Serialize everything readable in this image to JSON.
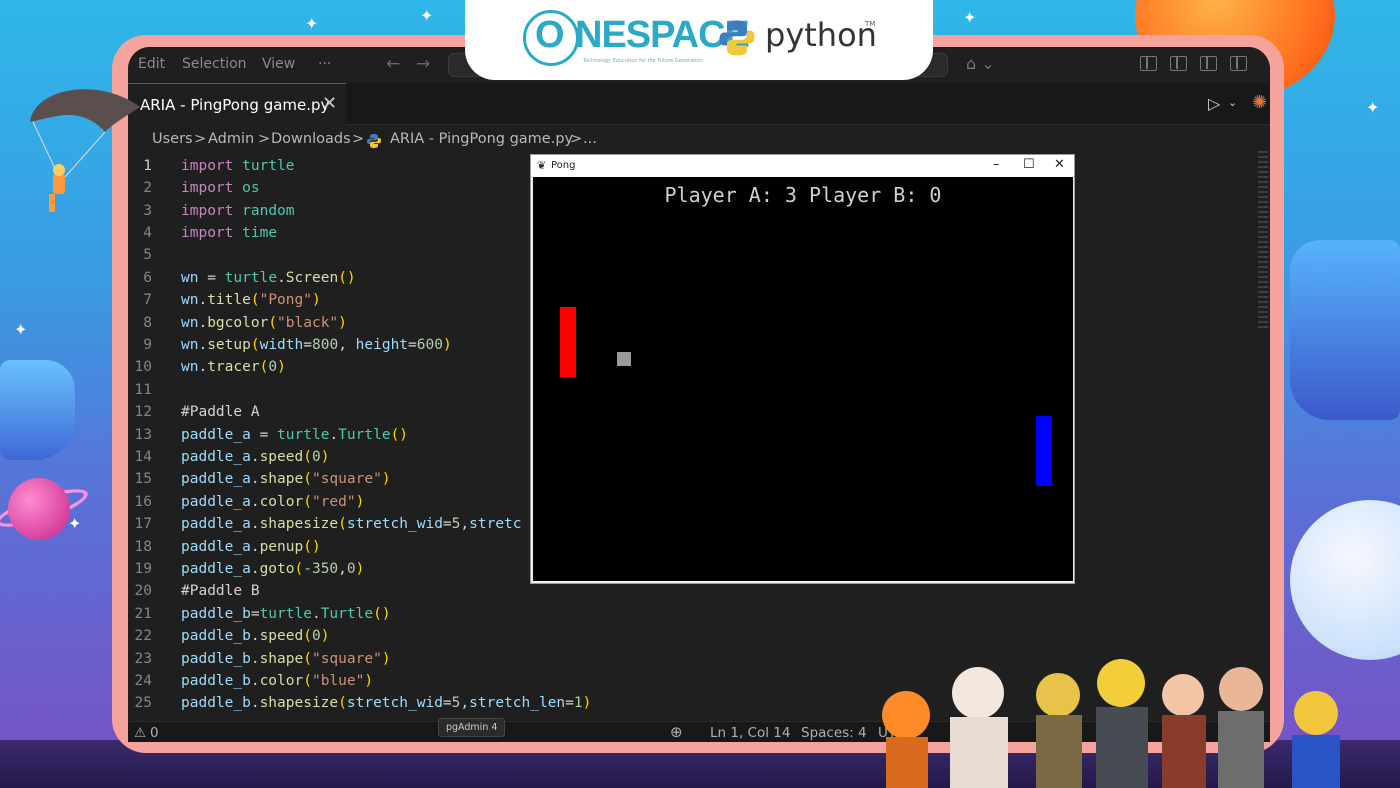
{
  "editor": {
    "menu": [
      "Edit",
      "Selection",
      "View",
      "···"
    ],
    "tab": {
      "label": "ARIA - PingPong game.py"
    },
    "breadcrumb": [
      "Users",
      "Admin",
      "Downloads",
      "ARIA - PingPong game.py",
      "..."
    ],
    "code_lines": [
      {
        "n": "1"
      },
      {
        "n": "2"
      },
      {
        "n": "3"
      },
      {
        "n": "4"
      },
      {
        "n": "5"
      },
      {
        "n": "6"
      },
      {
        "n": "7"
      },
      {
        "n": "8"
      },
      {
        "n": "9"
      },
      {
        "n": "10"
      },
      {
        "n": "11"
      },
      {
        "n": "12"
      },
      {
        "n": "13"
      },
      {
        "n": "14"
      },
      {
        "n": "15"
      },
      {
        "n": "16"
      },
      {
        "n": "17"
      },
      {
        "n": "18"
      },
      {
        "n": "19"
      },
      {
        "n": "20"
      },
      {
        "n": "21"
      },
      {
        "n": "22"
      },
      {
        "n": "23"
      },
      {
        "n": "24"
      },
      {
        "n": "25"
      }
    ],
    "code": {
      "l1": [
        "import",
        "turtle"
      ],
      "l2": [
        "import",
        "os"
      ],
      "l3": [
        "import",
        "random"
      ],
      "l4": [
        "import",
        "time"
      ],
      "l6": [
        "wn",
        " = ",
        "turtle",
        ".",
        "Screen",
        "()"
      ],
      "l7": [
        "wn",
        ".",
        "title",
        "(",
        "\"Pong\"",
        ")"
      ],
      "l8": [
        "wn",
        ".",
        "bgcolor",
        "(",
        "\"black\"",
        ")"
      ],
      "l9": [
        "wn",
        ".",
        "setup",
        "(",
        "width",
        "=",
        "800",
        ", ",
        "height",
        "=",
        "600",
        ")"
      ],
      "l10": [
        "wn",
        ".",
        "tracer",
        "(",
        "0",
        ")"
      ],
      "l12": "#Paddle A",
      "l13": [
        "paddle_a",
        " = ",
        "turtle",
        ".",
        "Turtle",
        "()"
      ],
      "l14": [
        "paddle_a",
        ".",
        "speed",
        "(",
        "0",
        ")"
      ],
      "l15": [
        "paddle_a",
        ".",
        "shape",
        "(",
        "\"square\"",
        ")"
      ],
      "l16": [
        "paddle_a",
        ".",
        "color",
        "(",
        "\"red\"",
        ")"
      ],
      "l17": [
        "paddle_a",
        ".",
        "shapesize",
        "(",
        "stretch_wid",
        "=",
        "5",
        ",",
        "stretc"
      ],
      "l18": [
        "paddle_a",
        ".",
        "penup",
        "()"
      ],
      "l19": [
        "paddle_a",
        ".",
        "goto",
        "(",
        "-350",
        ",",
        "0",
        ")"
      ],
      "l20": "#Paddle B",
      "l21": [
        "paddle_b",
        "=",
        "turtle",
        ".",
        "Turtle",
        "()"
      ],
      "l22": [
        "paddle_b",
        ".",
        "speed",
        "(",
        "0",
        ")"
      ],
      "l23": [
        "paddle_b",
        ".",
        "shape",
        "(",
        "\"square\"",
        ")"
      ],
      "l24": [
        "paddle_b",
        ".",
        "color",
        "(",
        "\"blue\"",
        ")"
      ],
      "l25": [
        "paddle_b",
        ".",
        "shapesize",
        "(",
        "stretch_wid",
        "=",
        "5",
        ",",
        "stretch_len",
        "=",
        "1",
        ")"
      ]
    },
    "status": {
      "errors": "0",
      "tooltip": "pgAdmin 4",
      "position": "Ln 1, Col 14",
      "spaces": "Spaces: 4",
      "encoding": "UTF-8"
    }
  },
  "pong": {
    "window_title": "Pong",
    "score_text": "Player A: 3 Player B: 0",
    "paddle_a_color": "#ff0000",
    "paddle_b_color": "#0000ff",
    "ball_color": "#9a9a9a",
    "background": "#000000"
  },
  "banner": {
    "onespace": "NESPACE",
    "onespace_o": "O",
    "tagline": "Technology Education for the Future Generation",
    "python": "python",
    "tm": "TM"
  },
  "icons": [
    "parachute-figure",
    "close-icon",
    "run-icon",
    "sparkle-icon",
    "python-file-icon",
    "zoom-icon",
    "feather-icon"
  ]
}
